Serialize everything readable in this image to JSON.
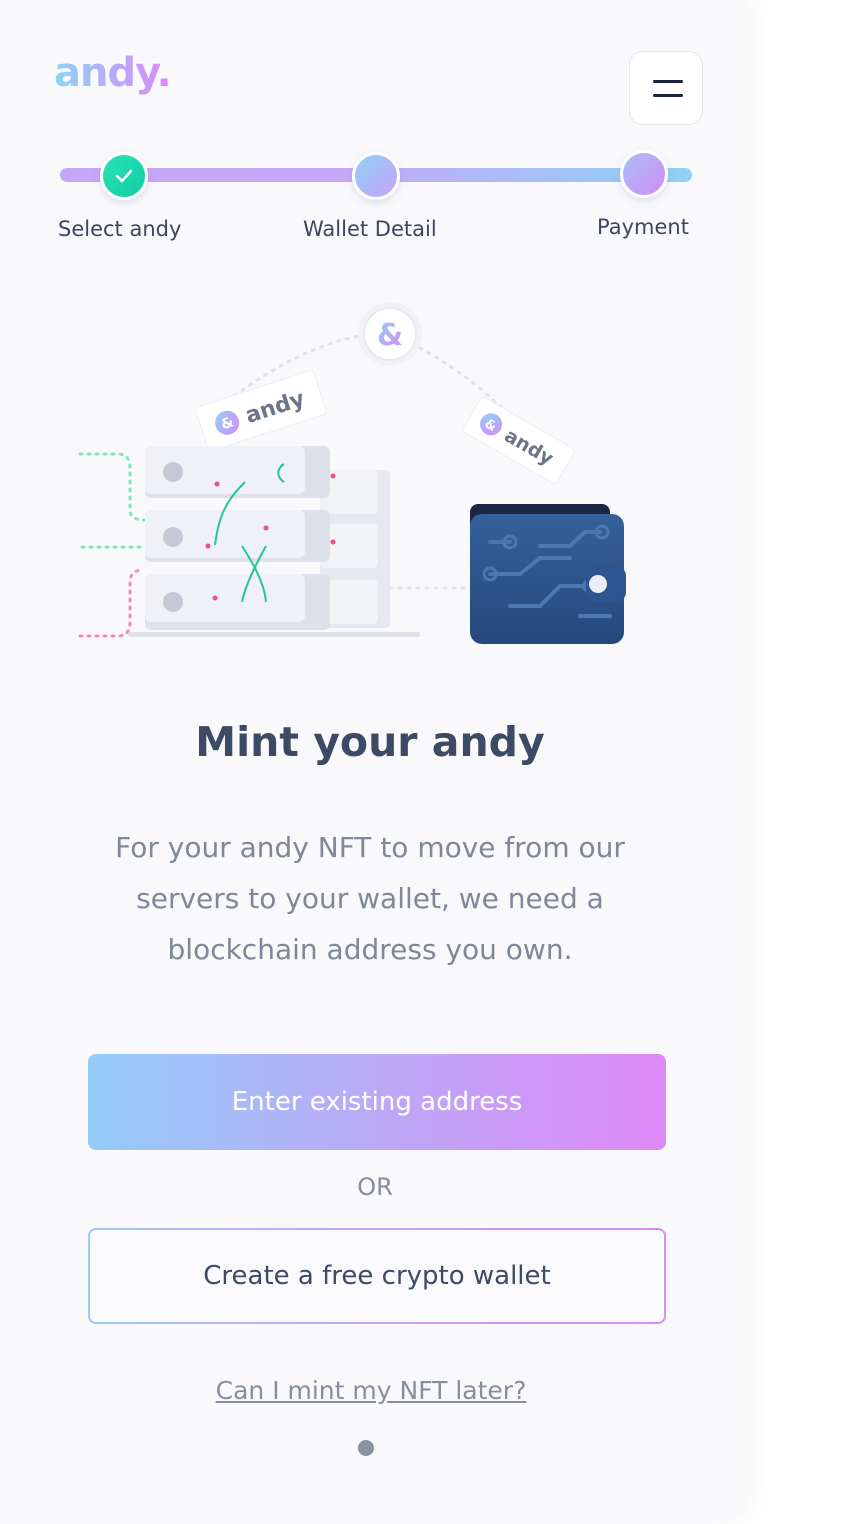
{
  "brand": {
    "logo": "andy."
  },
  "header": {
    "menu_icon": "hamburger-icon"
  },
  "stepper": {
    "steps": [
      {
        "label": "Select andy",
        "state": "complete"
      },
      {
        "label": "Wallet Detail",
        "state": "upcoming"
      },
      {
        "label": "Payment",
        "state": "upcoming"
      }
    ]
  },
  "illustration": {
    "badge_symbol": "&",
    "tag_left": "andy",
    "tag_right": "andy"
  },
  "main": {
    "title": "Mint your andy",
    "description": "For your andy NFT to move from our servers to your wallet, we need a blockchain address you own.",
    "primary_button": "Enter existing address",
    "or_label": "OR",
    "secondary_button": "Create a free crypto wallet",
    "later_link": "Can I mint my NFT later?"
  },
  "colors": {
    "accent_gradient_start": "#94cdf8",
    "accent_gradient_end": "#de88f7",
    "success": "#16d4a9",
    "text_dark": "#3d4a66",
    "text_muted": "#7f8799"
  }
}
